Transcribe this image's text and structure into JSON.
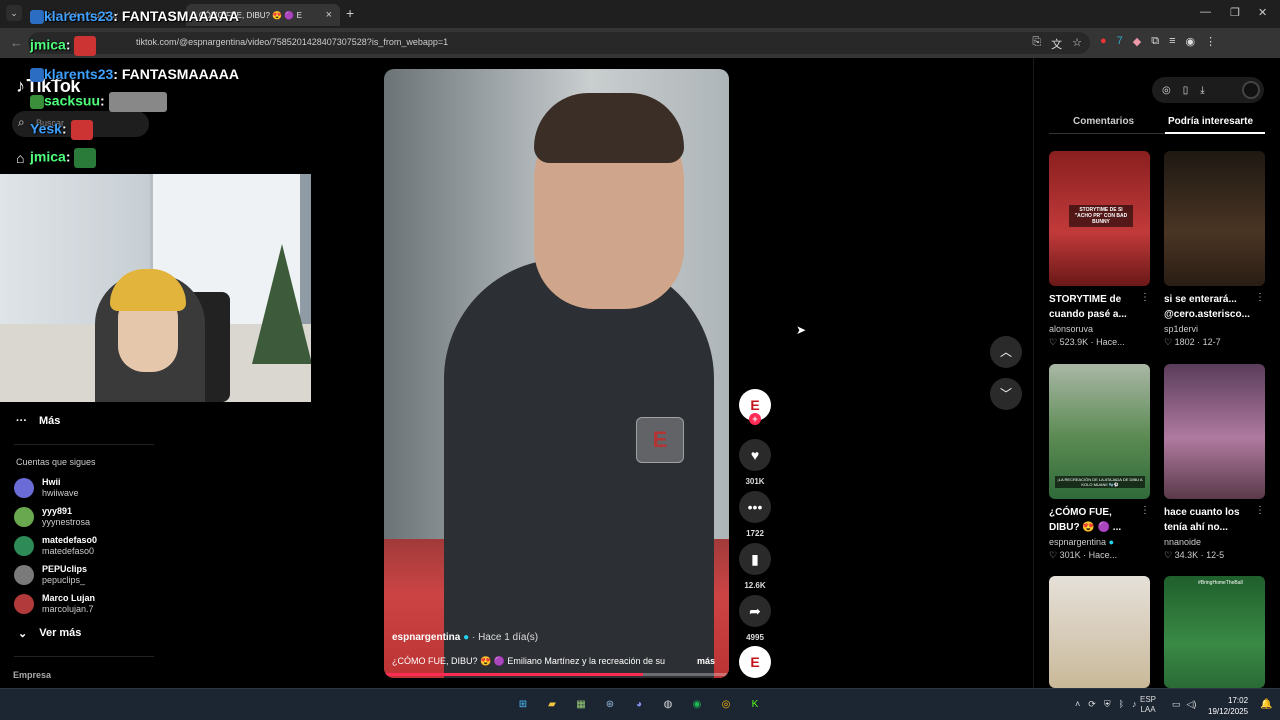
{
  "browser": {
    "tabs": [
      {
        "label": "TikTok - Make Your Day"
      },
      {
        "label": "¿CÓMO FUE, DIBU? 😍 🟣 E"
      }
    ],
    "url": "tiktok.com/@espnargentina/video/7585201428407307528?is_from_webapp=1"
  },
  "sidebar": {
    "logo": "TikTok",
    "search_placeholder": "Buscar",
    "more_label": "Más",
    "following_title": "Cuentas que sigues",
    "following": [
      {
        "name": "Hwii",
        "handle": "hwiiwave",
        "color": "#6b6bd6"
      },
      {
        "name": "yyy891",
        "handle": "yyynestrosa",
        "color": "#6aa84f"
      },
      {
        "name": "matedefaso0",
        "handle": "matedefaso0",
        "color": "#2e8b57"
      },
      {
        "name": "PEPUclips",
        "handle": "pepuclips_",
        "color": "#7a7a7a"
      },
      {
        "name": "Marco Lujan",
        "handle": "marcolujan.7",
        "color": "#b33a3a"
      }
    ],
    "see_more": "Ver más",
    "company": "Empresa"
  },
  "chat_overlay": [
    {
      "user": "klarents23",
      "message": ": FANTASMAAAAA"
    },
    {
      "user": "jmica",
      "message": ":"
    },
    {
      "user": "klarents23",
      "message": ": FANTASMAAAAA"
    },
    {
      "user": "sacksuu",
      "message": ":"
    },
    {
      "user": "Yesk",
      "message": ":"
    },
    {
      "user": "jmica",
      "message": ":"
    }
  ],
  "video": {
    "watermark": "E",
    "author": "espnargentina",
    "time": "· Hace 1 día(s)",
    "description": "¿CÓMO FUE, DIBU? 😍 🟣 Emiliano Martínez y la recreación de su",
    "more": "más",
    "progress": 0.75
  },
  "actions": {
    "avatar": "E",
    "likes": "301K",
    "comments": "1722",
    "saves": "12.6K",
    "shares": "4995"
  },
  "right_panel": {
    "tabs": [
      "Comentarios",
      "Podría interesarte"
    ],
    "active_tab": 1,
    "cards": [
      {
        "title": "STORYTIME de cuando pasé a...",
        "author": "alonsoruva",
        "likes": "523.9K",
        "date": "Hace...",
        "caption": "STORYTIME DE SI \"ACHO PR\" CON BAD BUNNY",
        "bg": "#a02a2a"
      },
      {
        "title": "si se enterará... @cero.asterisco...",
        "author": "sp1dervi",
        "likes": "1802",
        "date": "12-7",
        "caption": "",
        "bg": "#3b2a1e"
      },
      {
        "title": "¿CÓMO FUE, DIBU? 😍 🟣 ...",
        "author": "espnargentina",
        "likes": "301K",
        "date": "Hace...",
        "caption": "¡LA RECREACIÓN DE LA ATAJADA DE DIBU A KOLO MUANI! 🧤⚽",
        "bg": "#2f6a3a"
      },
      {
        "title": "hace cuanto los tenía ahí no...",
        "author": "nnanoide",
        "likes": "34.3K",
        "date": "12-5",
        "caption": "",
        "bg": "#7a4a6a"
      },
      {
        "title": "",
        "author": "",
        "likes": "",
        "date": "",
        "caption": "",
        "bg": "#c9c2b8"
      },
      {
        "title": "",
        "author": "",
        "likes": "",
        "date": "",
        "caption": "#BringHomeTheBall",
        "bg": "#2f7a3a"
      }
    ]
  },
  "taskbar": {
    "lang": "ESP",
    "layout": "LAA",
    "time": "17:02",
    "date": "19/12/2025"
  }
}
